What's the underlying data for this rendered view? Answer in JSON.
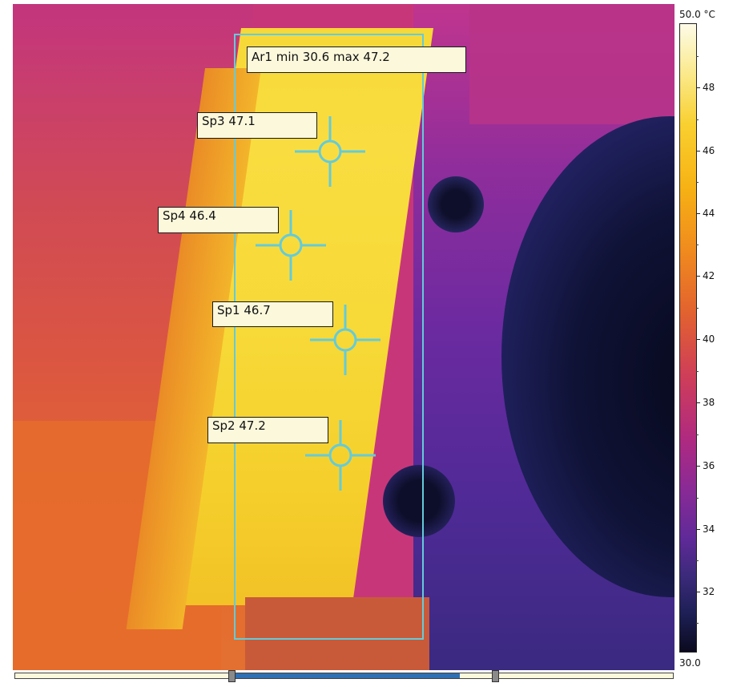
{
  "area": {
    "name": "Ar1",
    "min": "30.6",
    "max": "47.2",
    "label": "Ar1 min 30.6 max 47.2"
  },
  "spots": [
    {
      "id": "Sp3",
      "value": "47.1",
      "label": "Sp3 47.1"
    },
    {
      "id": "Sp4",
      "value": "46.4",
      "label": "Sp4 46.4"
    },
    {
      "id": "Sp1",
      "value": "46.7",
      "label": "Sp1 46.7"
    },
    {
      "id": "Sp2",
      "value": "47.2",
      "label": "Sp2 47.2"
    }
  ],
  "scale": {
    "max_label": "50.0 °C",
    "min_label": "30.0",
    "ticks": [
      "48",
      "46",
      "44",
      "42",
      "40",
      "38",
      "36",
      "34",
      "32"
    ],
    "max_value": 50.0,
    "min_value": 30.0
  },
  "colors": {
    "overlay": "#64cbd9",
    "label_background": "#fbf8dc",
    "slider_range": "#2f6fb3"
  },
  "icons": {
    "spot_marker": "crosshair-icon"
  }
}
